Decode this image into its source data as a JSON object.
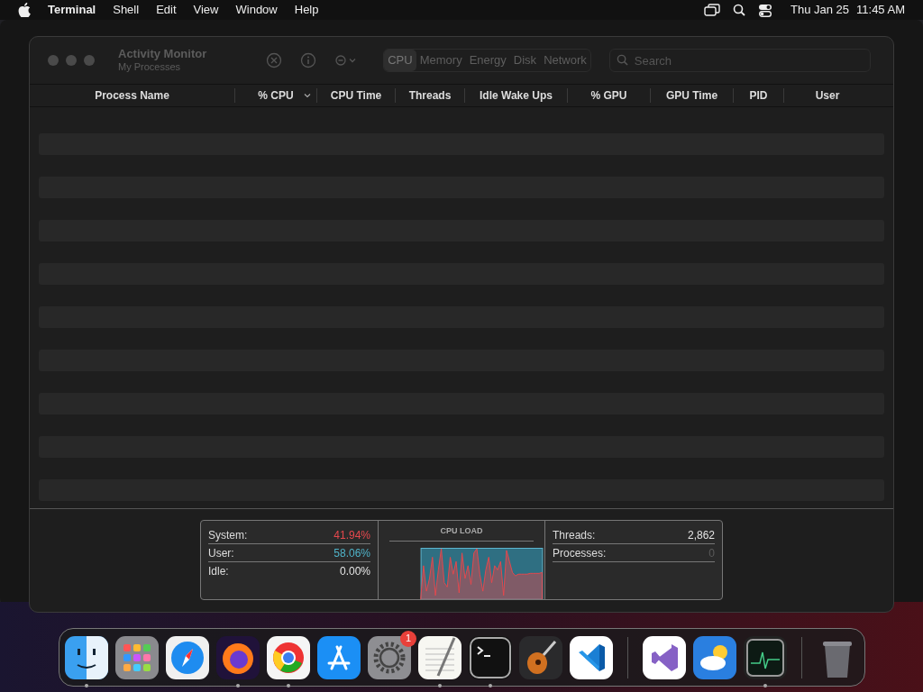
{
  "menu_bar": {
    "app": "Terminal",
    "menus": [
      "Shell",
      "Edit",
      "View",
      "Window",
      "Help"
    ],
    "date": "Thu Jan 25",
    "time": "11:45 AM"
  },
  "window": {
    "title": "Activity Monitor",
    "subtitle": "My Processes",
    "tabs": [
      {
        "label": "CPU",
        "selected": true
      },
      {
        "label": "Memory",
        "selected": false
      },
      {
        "label": "Energy",
        "selected": false
      },
      {
        "label": "Disk",
        "selected": false
      },
      {
        "label": "Network",
        "selected": false
      }
    ],
    "search": {
      "placeholder": "Search"
    }
  },
  "table": {
    "columns": [
      {
        "label": "Process Name",
        "sorted": false
      },
      {
        "label": "% CPU",
        "sorted": true
      },
      {
        "label": "CPU Time",
        "sorted": false
      },
      {
        "label": "Threads",
        "sorted": false
      },
      {
        "label": "Idle Wake Ups",
        "sorted": false
      },
      {
        "label": "% GPU",
        "sorted": false
      },
      {
        "label": "GPU Time",
        "sorted": false
      },
      {
        "label": "PID",
        "sorted": false
      },
      {
        "label": "User",
        "sorted": false
      }
    ]
  },
  "cpu_stats": [
    {
      "label": "System:",
      "value": "41.94%",
      "color": "#e5484d"
    },
    {
      "label": "User:",
      "value": "58.06%",
      "color": "#4fb3c8"
    },
    {
      "label": "Idle:",
      "value": "0.00%",
      "color": "#e5e5e5"
    }
  ],
  "cpu_load": {
    "title": "CPU LOAD"
  },
  "totals": [
    {
      "label": "Threads:",
      "value": "2,862",
      "color": "#e5e5e5"
    },
    {
      "label": "Processes:",
      "value": "0",
      "color": "#5a5a5a"
    }
  ],
  "dock": [
    {
      "running": true
    },
    {
      "running": false
    },
    {
      "running": false
    },
    {
      "running": true
    },
    {
      "running": true
    },
    {
      "running": false
    },
    {
      "running": false,
      "badge": "1"
    },
    {
      "running": true
    },
    {
      "running": true
    },
    {
      "running": false
    },
    {
      "running": false
    },
    {
      "running": false
    },
    {
      "running": false
    },
    {
      "running": true
    },
    {
      "running": false
    }
  ]
}
